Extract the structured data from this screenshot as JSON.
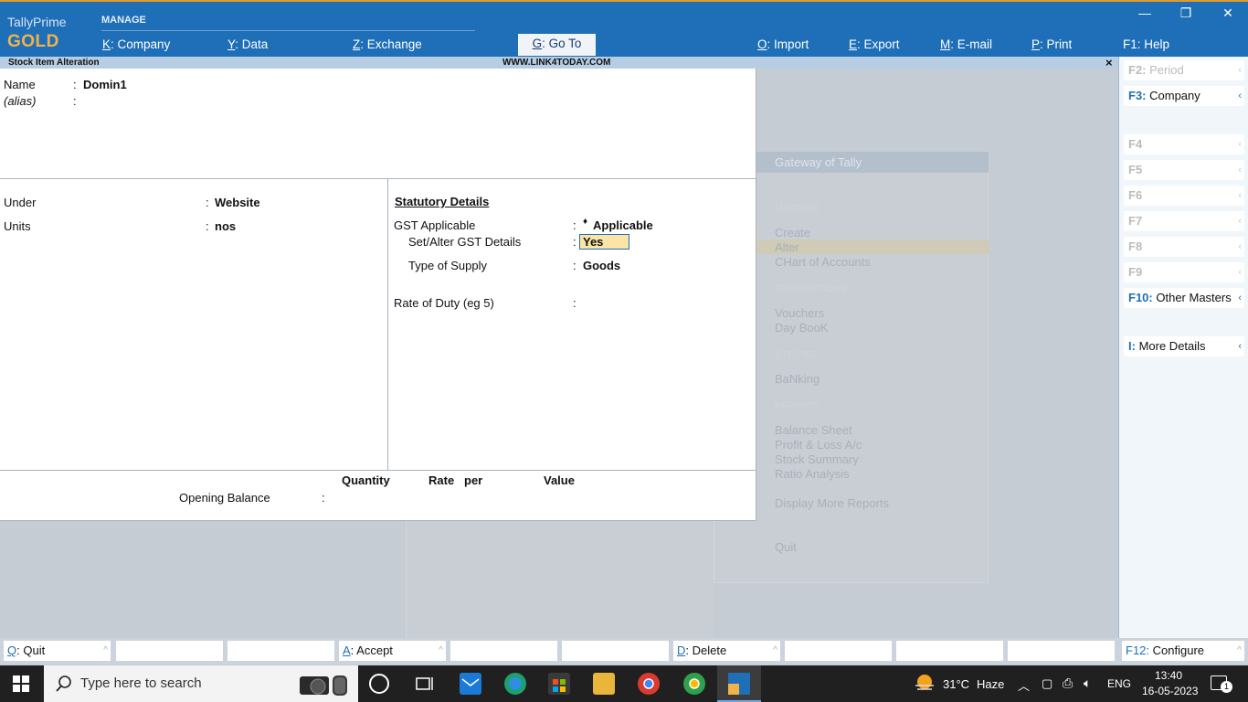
{
  "app": {
    "brand_line1": "TallyPrime",
    "brand_line2": "GOLD",
    "manage_label": "MANAGE"
  },
  "topmenu": [
    {
      "key": "K",
      "label": "Company"
    },
    {
      "key": "Y",
      "label": "Data"
    },
    {
      "key": "Z",
      "label": "Exchange"
    },
    {
      "key": "G",
      "label": "Go To"
    },
    {
      "key": "O",
      "label": "Import"
    },
    {
      "key": "E",
      "label": "Export"
    },
    {
      "key": "M",
      "label": "E-mail"
    },
    {
      "key": "P",
      "label": "Print"
    },
    {
      "key": "F1",
      "label": "Help"
    }
  ],
  "window_controls": {
    "minimize": "—",
    "restore": "❐",
    "close": "✕"
  },
  "titlebar": {
    "title": "Stock Item Alteration",
    "watermark": "WWW.LINK4TODAY.COM",
    "close": "×"
  },
  "form": {
    "name_label": "Name",
    "name_value": "Domin1",
    "alias_label": "(alias)",
    "under_label": "Under",
    "under_value": "Website",
    "units_label": "Units",
    "units_value": "nos",
    "statutory_heading": "Statutory Details",
    "gst_label": "GST Applicable",
    "gst_value": "Applicable",
    "gst_bullet": "♦",
    "setalter_label": "Set/Alter GST Details",
    "setalter_value": "Yes",
    "supply_label": "Type of Supply",
    "supply_value": "Goods",
    "duty_label": "Rate of Duty (eg 5)",
    "col_quantity": "Quantity",
    "col_rate": "Rate",
    "col_per": "per",
    "col_value": "Value",
    "opening_label": "Opening Balance",
    "colon": ":"
  },
  "gateway": {
    "title": "Gateway of Tally",
    "sec_masters": "MASTERS",
    "create": "Create",
    "alter": "Alter",
    "coa": "CHart of Accounts",
    "sec_transactions": "TRANSACTIONS",
    "vouchers": "Vouchers",
    "daybook": "Day BooK",
    "sec_utilities": "UTILITIES",
    "banking": "BaNking",
    "sec_reports": "REPORTS",
    "balance": "Balance Sheet",
    "pl": "Profit & Loss A/c",
    "stock": "Stock Summary",
    "ratio": "Ratio Analysis",
    "display_more": "Display More Reports",
    "quit": "Quit"
  },
  "sidebar": [
    {
      "key": "F2:",
      "label": "Period",
      "active": false
    },
    {
      "key": "F3:",
      "label": "Company",
      "active": true
    },
    {
      "key": "F4",
      "label": "",
      "active": false
    },
    {
      "key": "F5",
      "label": "",
      "active": false
    },
    {
      "key": "F6",
      "label": "",
      "active": false
    },
    {
      "key": "F7",
      "label": "",
      "active": false
    },
    {
      "key": "F8",
      "label": "",
      "active": false
    },
    {
      "key": "F9",
      "label": "",
      "active": false
    },
    {
      "key": "F10:",
      "label": "Other Masters",
      "active": true
    },
    {
      "key": "I:",
      "label": "More Details",
      "active": true
    }
  ],
  "bottom": {
    "quit_key": "Q",
    "quit_label": ": Quit",
    "accept_key": "A",
    "accept_label": ": Accept",
    "delete_key": "D",
    "delete_label": ": Delete",
    "configure_key": "F12:",
    "configure_label": "Configure"
  },
  "taskbar": {
    "search_placeholder": "Type here to search",
    "temperature": "31°C",
    "weather": "Haze",
    "lang": "ENG",
    "time": "13:40",
    "date": "16-05-2023",
    "notification_count": "1"
  },
  "colors": {
    "brand_blue": "#1e6fb8",
    "gold": "#f1b24a",
    "highlight": "#fbe4a6"
  }
}
